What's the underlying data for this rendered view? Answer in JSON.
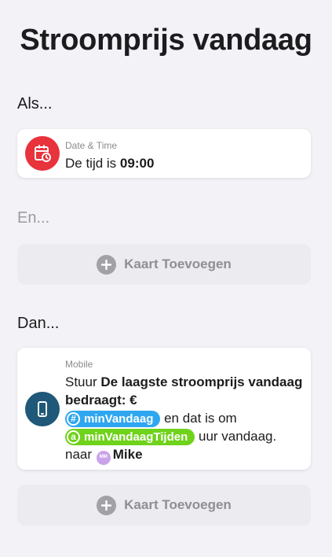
{
  "title": "Stroomprijs vandaag",
  "sections": {
    "when": "Als...",
    "and": "En...",
    "then": "Dan..."
  },
  "trigger_card": {
    "category": "Date & Time",
    "text_prefix": "De tijd is ",
    "time": "09:00",
    "icon": "calendar-clock-icon",
    "icon_color": "#e8323c"
  },
  "and_add_label": "Kaart Toevoegen",
  "action_card": {
    "category": "Mobile",
    "send_prefix": "Stuur ",
    "message_part1": "De laagste stroomprijs vandaag bedraagt: €",
    "tag1": "minVandaag",
    "tag1_symbol": "#",
    "tag1_color": "#2fa7f0",
    "message_part2": " en dat is om",
    "tag2": "minVandaagTijden",
    "tag2_symbol": "a",
    "tag2_color": "#6fd21b",
    "message_part3": " uur vandaag.",
    "to_prefix": "naar ",
    "avatar_initials": "MM",
    "recipient": "Mike",
    "icon": "mobile-phone-icon",
    "icon_color": "#1f5878"
  },
  "then_add_label": "Kaart Toevoegen"
}
